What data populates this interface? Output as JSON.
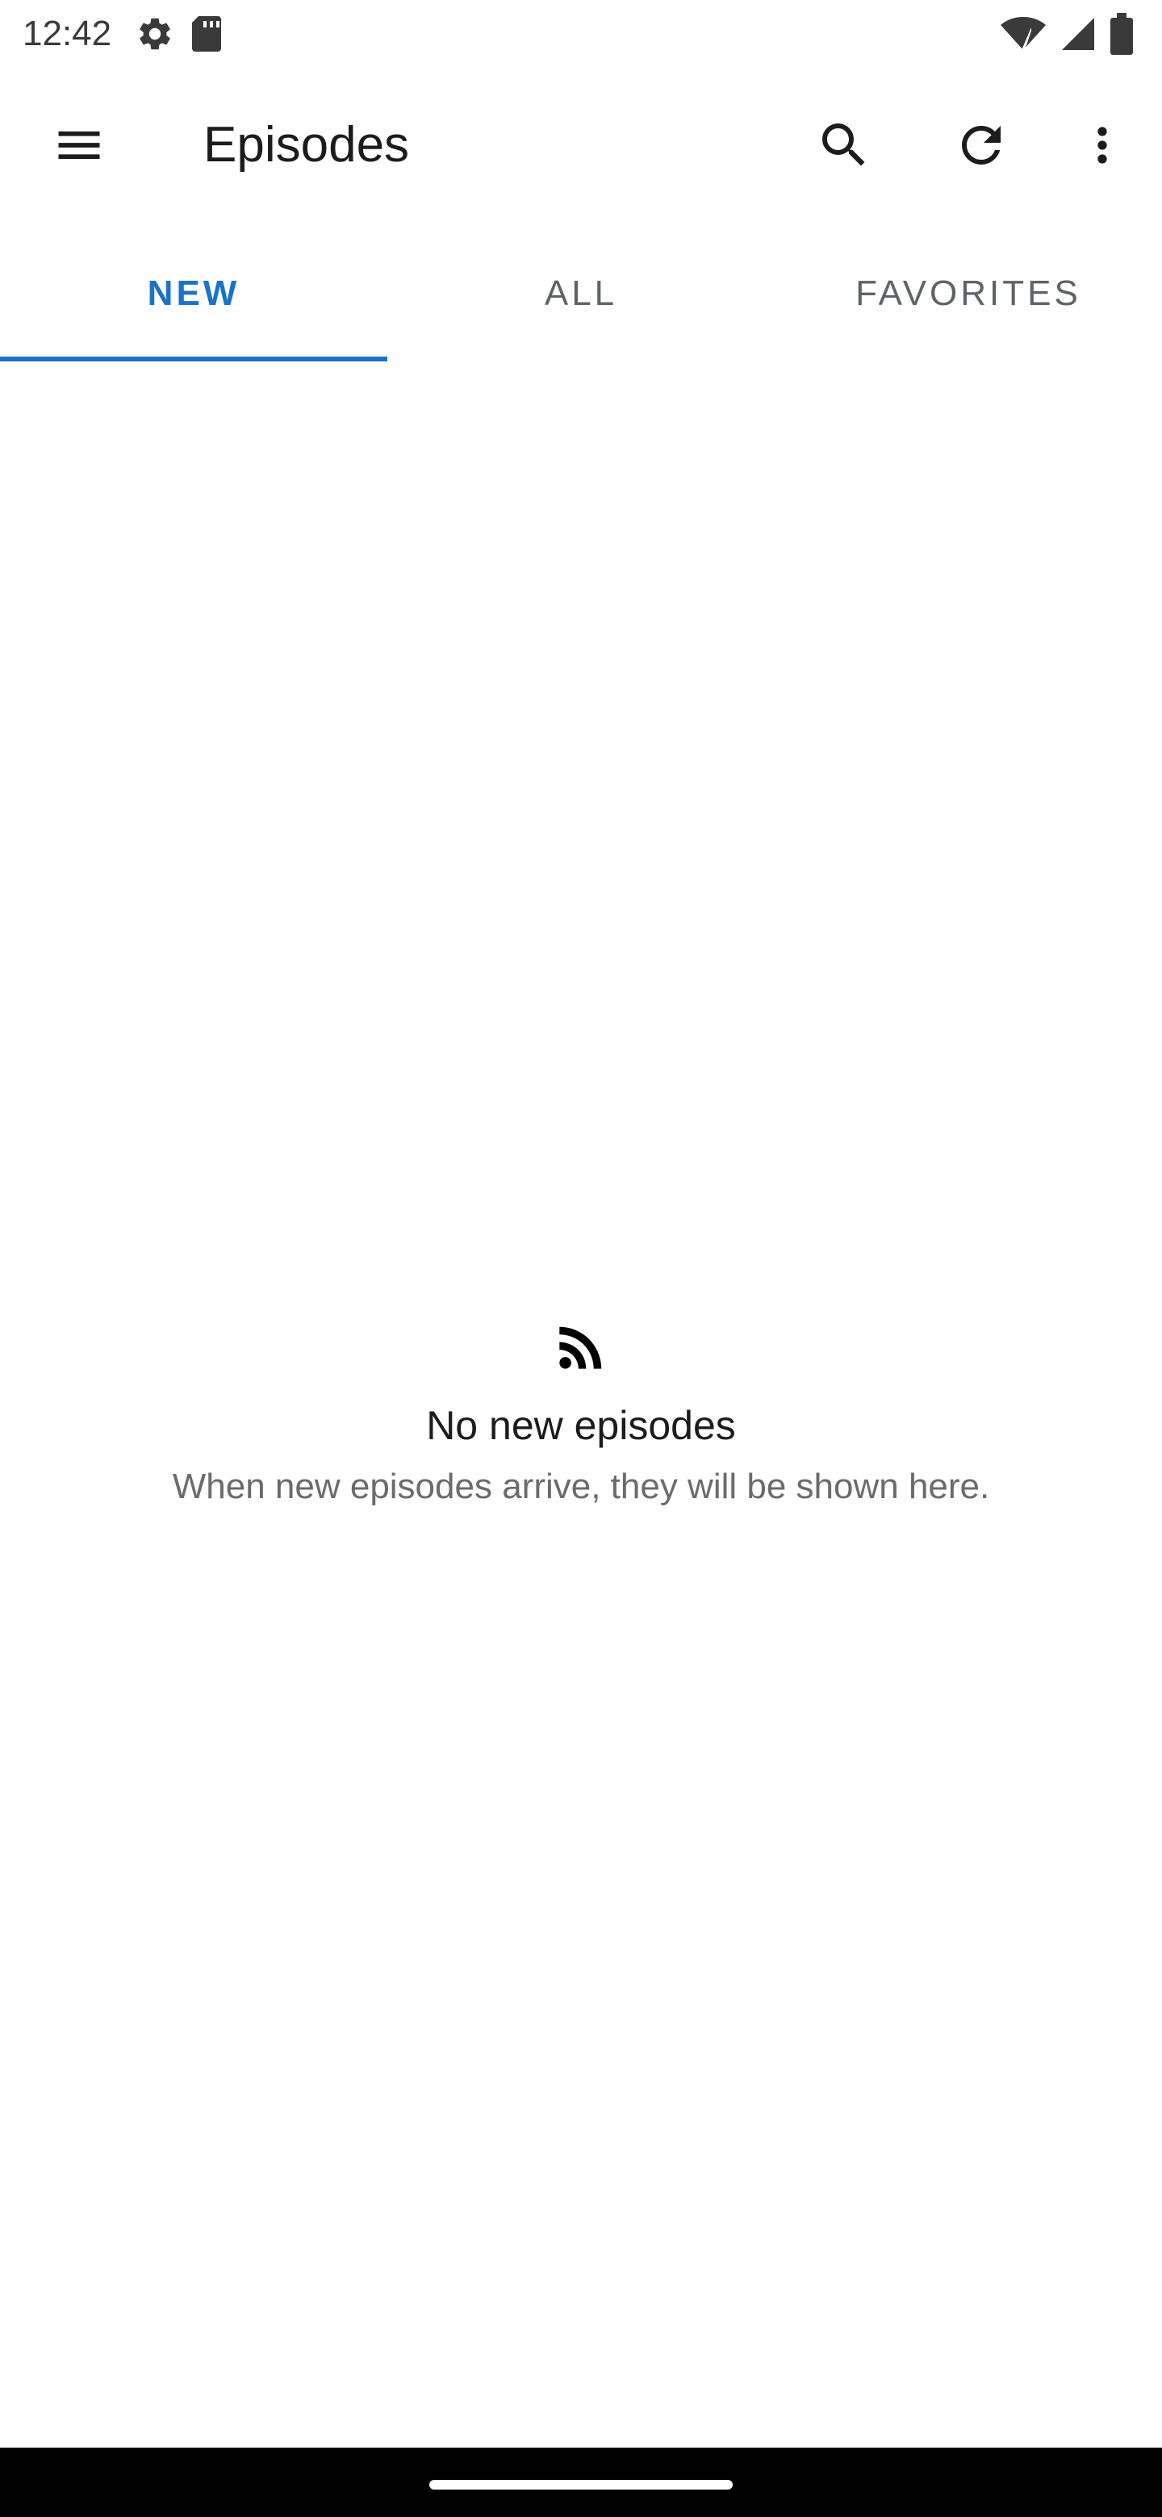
{
  "status_bar": {
    "time": "12:42",
    "icons": [
      "settings-icon",
      "sd-card-icon",
      "wifi-icon",
      "signal-icon",
      "battery-icon"
    ]
  },
  "app_bar": {
    "title": "Episodes",
    "icons": [
      "menu-icon",
      "search-icon",
      "refresh-icon",
      "more-vert-icon"
    ]
  },
  "tabs": [
    {
      "label": "NEW",
      "active": true
    },
    {
      "label": "ALL",
      "active": false
    },
    {
      "label": "FAVORITES",
      "active": false
    }
  ],
  "empty_state": {
    "icon": "rss-feed-icon",
    "title": "No new episodes",
    "subtitle": "When new episodes arrive, they will be shown here."
  },
  "colors": {
    "accent": "#1a73c8",
    "text_primary": "#1c1c1c",
    "text_secondary": "#6b6b6b",
    "nav_bar": "#000000"
  }
}
